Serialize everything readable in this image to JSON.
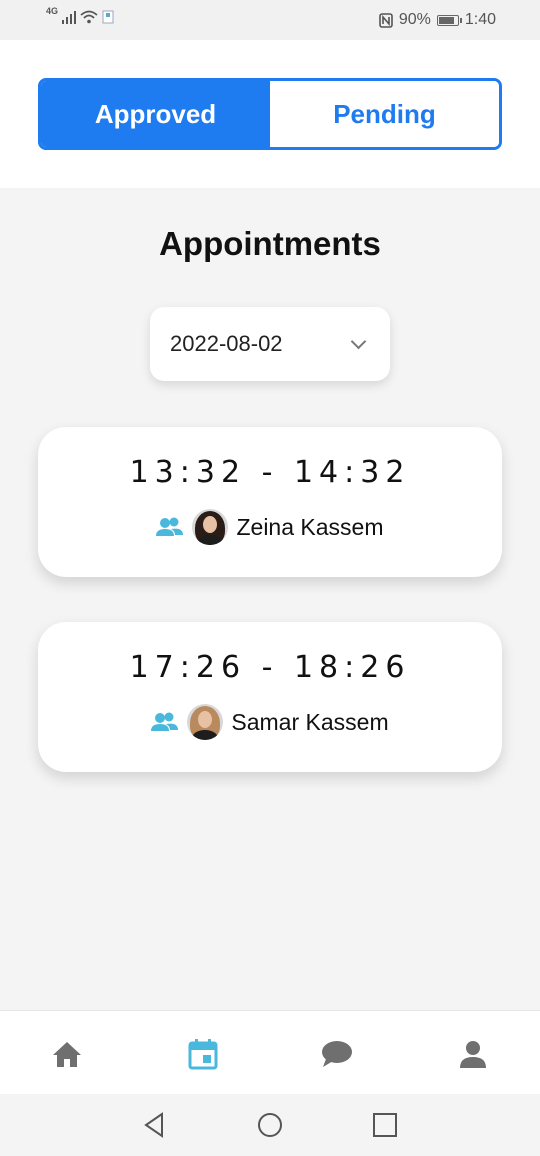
{
  "status_bar": {
    "network": "4G",
    "battery": "90%",
    "battery_level": 0.9,
    "time": "1:40"
  },
  "tabs": [
    {
      "label": "Approved",
      "active": true
    },
    {
      "label": "Pending",
      "active": false
    }
  ],
  "page_title": "Appointments",
  "date_filter": {
    "value": "2022-08-02"
  },
  "appointments": [
    {
      "time": "13:32 - 14:32",
      "name": "Zeina Kassem"
    },
    {
      "time": "17:26 - 18:26",
      "name": "Samar Kassem"
    }
  ],
  "bottom_nav": [
    {
      "icon": "home-icon",
      "active": false
    },
    {
      "icon": "calendar-icon",
      "active": true
    },
    {
      "icon": "chat-icon",
      "active": false
    },
    {
      "icon": "person-icon",
      "active": false
    }
  ],
  "colors": {
    "primary": "#1f7cf0",
    "accent": "#4ab8dc",
    "nav_inactive": "#6f6f6f"
  }
}
